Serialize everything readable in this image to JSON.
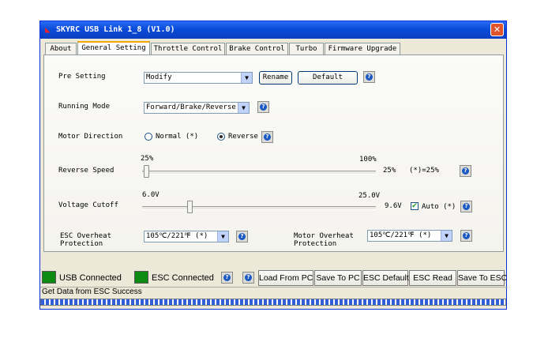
{
  "window": {
    "title": "SKYRC USB Link 1_8 (V1.0)"
  },
  "tabs": [
    {
      "label": "About"
    },
    {
      "label": "General Setting",
      "active": true
    },
    {
      "label": "Throttle Control"
    },
    {
      "label": "Brake Control"
    },
    {
      "label": "Turbo"
    },
    {
      "label": "Firmware Upgrade"
    }
  ],
  "pre_setting": {
    "label": "Pre Setting",
    "value": "Modify",
    "rename": "Rename",
    "default": "Default"
  },
  "running_mode": {
    "label": "Running Mode",
    "value": "Forward/Brake/Reverse"
  },
  "motor_direction": {
    "label": "Motor Direction",
    "option_normal": "Normal (*)",
    "option_reverse": "Reverse",
    "selected": "Reverse"
  },
  "reverse_speed": {
    "label": "Reverse Speed",
    "min": "25%",
    "max": "100%",
    "value": "25%",
    "default_note": "(*)=25%",
    "level": 0
  },
  "voltage_cutoff": {
    "label": "Voltage Cutoff",
    "min": "6.0V",
    "max": "25.0V",
    "value": "9.6V",
    "auto_label": "Auto (*)",
    "auto_checked": true,
    "level": 0.19
  },
  "esc_overheat": {
    "label_line1": "ESC Overheat",
    "label_line2": "Protection",
    "value": "105℃/221℉ (*)"
  },
  "motor_overheat": {
    "label_line1": "Motor Overheat",
    "label_line2": "Protection",
    "value": "105℃/221℉ (*)"
  },
  "bottom": {
    "usb_status": "USB Connected",
    "esc_status": "ESC Connected",
    "led_color": "#0c8a12",
    "buttons": {
      "load_pc": "Load From PC",
      "save_pc": "Save To PC",
      "esc_default": "ESC Default",
      "esc_read": "ESC Read",
      "save_esc": "Save To ESC"
    }
  },
  "status_message": "Get Data from ESC Success",
  "icons": {
    "help": "question-icon",
    "close": "close-icon",
    "dropdown": "chevron-down-icon"
  }
}
